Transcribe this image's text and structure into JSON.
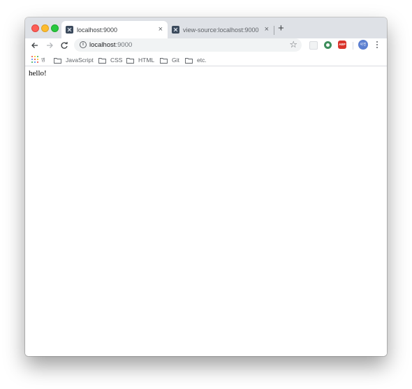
{
  "tabs": [
    {
      "title": "localhost:9000",
      "close": "×",
      "active": true
    },
    {
      "title": "view-source:localhost:9000",
      "close": "×",
      "active": false
    }
  ],
  "new_tab": "+",
  "toolbar": {
    "back_icon": "arrow-left-icon",
    "forward_icon": "arrow-right-icon",
    "reload_icon": "reload-icon",
    "omnibox": {
      "info_icon": "i",
      "host": "localhost",
      "port": ":9000",
      "star": "☆"
    },
    "extensions": {
      "abp": "ABP"
    },
    "avatar": "사진"
  },
  "bookmarks": {
    "apps_label": "앱",
    "items": [
      {
        "label": "JavaScript"
      },
      {
        "label": "CSS"
      },
      {
        "label": "HTML"
      },
      {
        "label": "Git"
      },
      {
        "label": "etc."
      }
    ]
  },
  "page": {
    "body_text": "hello!"
  },
  "colors": {
    "tabstrip_bg": "#dee1e6",
    "omnibox_bg": "#f1f3f4",
    "traffic_close": "#fd5f57",
    "traffic_min": "#febc2e",
    "traffic_max": "#28c840",
    "abp_red": "#d9342b",
    "avatar_blue": "#5b7fd1"
  }
}
